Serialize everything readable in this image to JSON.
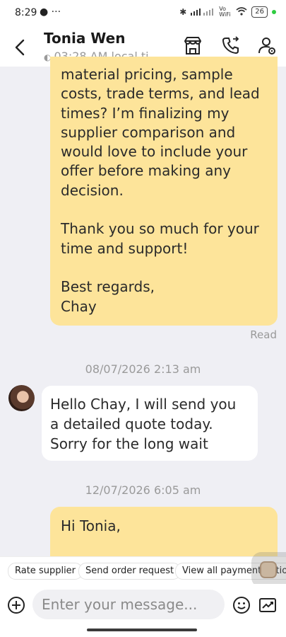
{
  "status_bar": {
    "time": "8:29",
    "left_icons": "● ···",
    "battery": "26",
    "network_label": "Vo WiFi"
  },
  "header": {
    "contact_name": "Tonia Wen",
    "local_time": "03:28 AM local ti..."
  },
  "messages": {
    "outgoing_1_lines": [
      "material pricing, sample",
      "costs, trade terms, and lead",
      "times? I’m finalizing my",
      "supplier comparison and",
      "would love to include your",
      "offer before making any",
      "decision.",
      "",
      "Thank you so much for your",
      "time and support!",
      "",
      "Best regards,",
      "Chay"
    ],
    "read_status": "Read",
    "date_1": "08/07/2026 2:13 am",
    "incoming_1_lines": [
      "Hello Chay, I will send you",
      "a detailed quote today.",
      "Sorry for the long wait"
    ],
    "date_2": "12/07/2026 6:05 am",
    "outgoing_2_lines": [
      "Hi Tonia,"
    ]
  },
  "quick_actions": [
    "Rate supplier",
    "Send order request",
    "View all payment options"
  ],
  "composer": {
    "placeholder": "Enter your message..."
  },
  "colors": {
    "outgoing_bubble": "#fde49a",
    "incoming_bubble": "#ffffff",
    "chat_background": "#efeff4"
  }
}
